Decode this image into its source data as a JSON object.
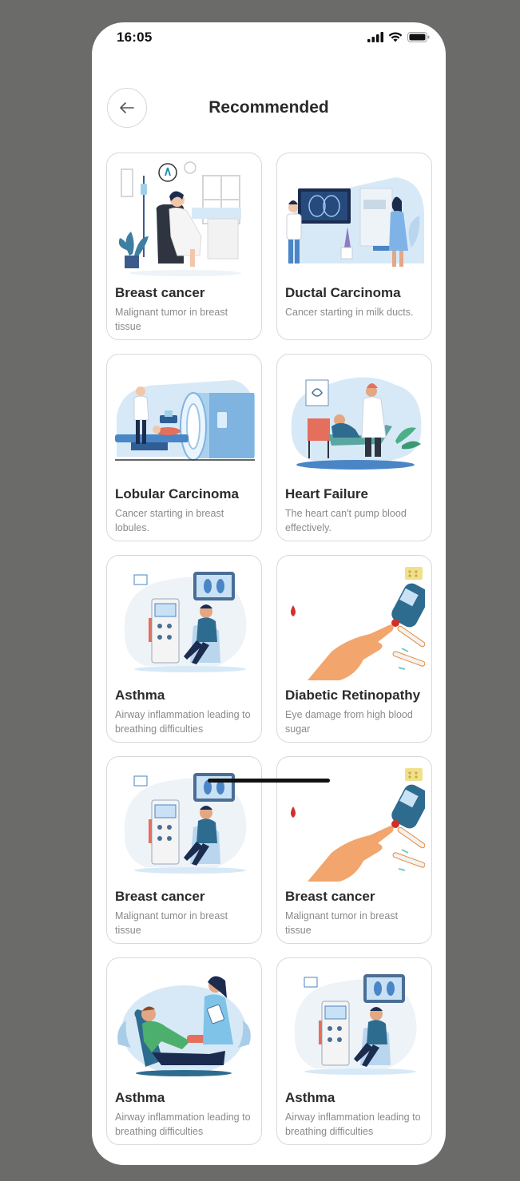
{
  "status_bar": {
    "time": "16:05"
  },
  "header": {
    "title": "Recommended"
  },
  "colors": {
    "card_border": "#d9d9d9",
    "title_text": "#2b2b2b",
    "desc_text": "#8a8a8a",
    "illustration_blue": "#d7e9f7"
  },
  "cards": [
    {
      "title": "Breast cancer",
      "description": "Malignant tumor in breast tissue",
      "illustration": "patient-in-chair-with-iv"
    },
    {
      "title": "Ductal Carcinoma",
      "description": "Cancer starting in milk ducts.",
      "illustration": "doctor-with-xray-screen"
    },
    {
      "title": "Lobular Carcinoma",
      "description": "Cancer starting in breast lobules.",
      "illustration": "mri-scanner"
    },
    {
      "title": "Heart Failure",
      "description": "The heart can't pump blood effectively.",
      "illustration": "doctor-examining-patient"
    },
    {
      "title": "Asthma",
      "description": "Airway inflammation leading to breathing difficulties",
      "illustration": "dialysis-patient"
    },
    {
      "title": "Diabetic Retinopathy",
      "description": "Eye damage from high blood sugar",
      "illustration": "glucose-meter-finger"
    },
    {
      "title": "Breast cancer",
      "description": "Malignant tumor in breast tissue",
      "illustration": "dialysis-patient"
    },
    {
      "title": "Breast cancer",
      "description": "Malignant tumor in breast tissue",
      "illustration": "glucose-meter-finger"
    },
    {
      "title": "Asthma",
      "description": "Airway inflammation leading to breathing difficulties",
      "illustration": "nurse-with-patient"
    },
    {
      "title": "Asthma",
      "description": "Airway inflammation leading to breathing difficulties",
      "illustration": "dialysis-patient"
    }
  ]
}
